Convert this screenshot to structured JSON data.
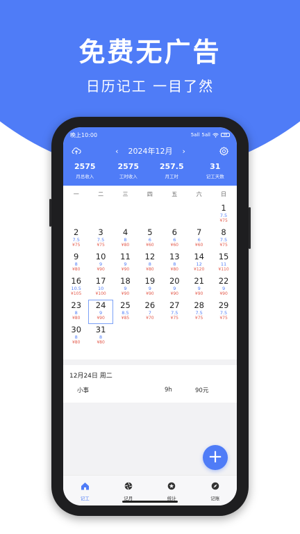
{
  "hero": {
    "title": "免费无广告",
    "subtitle": "日历记工 一目了然"
  },
  "status": {
    "time": "晚上10:00",
    "signal1": "5all",
    "signal2": "5all",
    "battery": "88"
  },
  "header": {
    "month": "2024年12月",
    "prev": "‹",
    "next": "›"
  },
  "stats": [
    {
      "value": "2575",
      "label": "月总收入"
    },
    {
      "value": "2575",
      "label": "工时收入"
    },
    {
      "value": "257.5",
      "label": "月工时"
    },
    {
      "value": "31",
      "label": "记工天数"
    }
  ],
  "weekdays": [
    "一",
    "二",
    "三",
    "四",
    "五",
    "六",
    "日"
  ],
  "calendar": {
    "leading_blanks": 6,
    "selected_day": "24",
    "days": [
      {
        "d": "1",
        "h": "7.5",
        "m": "¥75"
      },
      {
        "d": "2",
        "h": "7.5",
        "m": "¥75"
      },
      {
        "d": "3",
        "h": "7.5",
        "m": "¥75"
      },
      {
        "d": "4",
        "h": "8",
        "m": "¥80"
      },
      {
        "d": "5",
        "h": "6",
        "m": "¥60"
      },
      {
        "d": "6",
        "h": "6",
        "m": "¥60"
      },
      {
        "d": "7",
        "h": "6",
        "m": "¥60"
      },
      {
        "d": "8",
        "h": "7.5",
        "m": "¥75"
      },
      {
        "d": "9",
        "h": "8",
        "m": "¥80"
      },
      {
        "d": "10",
        "h": "9",
        "m": "¥90"
      },
      {
        "d": "11",
        "h": "9",
        "m": "¥90"
      },
      {
        "d": "12",
        "h": "8",
        "m": "¥80"
      },
      {
        "d": "13",
        "h": "8",
        "m": "¥80"
      },
      {
        "d": "14",
        "h": "12",
        "m": "¥120"
      },
      {
        "d": "15",
        "h": "11",
        "m": "¥110"
      },
      {
        "d": "16",
        "h": "10.5",
        "m": "¥105"
      },
      {
        "d": "17",
        "h": "10",
        "m": "¥100"
      },
      {
        "d": "18",
        "h": "9",
        "m": "¥90"
      },
      {
        "d": "19",
        "h": "9",
        "m": "¥90"
      },
      {
        "d": "20",
        "h": "9",
        "m": "¥90"
      },
      {
        "d": "21",
        "h": "9",
        "m": "¥90"
      },
      {
        "d": "22",
        "h": "9",
        "m": "¥90"
      },
      {
        "d": "23",
        "h": "8",
        "m": "¥80"
      },
      {
        "d": "24",
        "h": "9",
        "m": "¥90"
      },
      {
        "d": "25",
        "h": "8.5",
        "m": "¥85"
      },
      {
        "d": "26",
        "h": "7",
        "m": "¥70"
      },
      {
        "d": "27",
        "h": "7.5",
        "m": "¥75"
      },
      {
        "d": "28",
        "h": "7.5",
        "m": "¥75"
      },
      {
        "d": "29",
        "h": "7.5",
        "m": "¥75"
      },
      {
        "d": "30",
        "h": "8",
        "m": "¥80"
      },
      {
        "d": "31",
        "h": "8",
        "m": "¥80"
      }
    ]
  },
  "detail": {
    "date": "12月24日 周二",
    "item": "小事",
    "hours": "9h",
    "amount": "90元"
  },
  "fab": "+",
  "tabs": [
    {
      "label": "记工",
      "icon": "home-icon",
      "active": true
    },
    {
      "label": "记月",
      "icon": "aperture-icon",
      "active": false
    },
    {
      "label": "统计",
      "icon": "star-badge-icon",
      "active": false
    },
    {
      "label": "记账",
      "icon": "compass-icon",
      "active": false
    }
  ],
  "colors": {
    "accent": "#4f7cf7",
    "money": "#e35a4b"
  }
}
